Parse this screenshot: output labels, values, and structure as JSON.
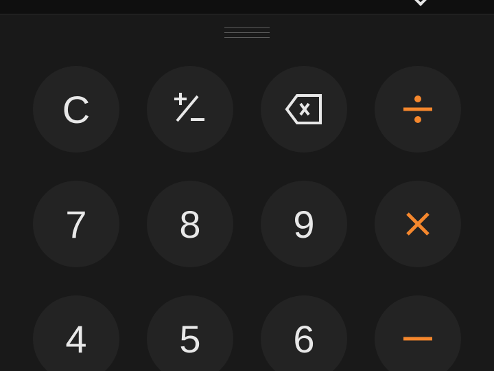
{
  "keypad": {
    "row1": {
      "clear": "C"
    },
    "row2": {
      "seven": "7",
      "eight": "8",
      "nine": "9"
    },
    "row3": {
      "four": "4",
      "five": "5",
      "six": "6"
    }
  },
  "icons": {
    "plus_minus": "plus-minus-icon",
    "backspace": "backspace-icon",
    "divide": "divide-icon",
    "multiply": "multiply-icon",
    "subtract": "minus-icon",
    "top_chevron": "chevron-down-icon"
  },
  "colors": {
    "background": "#191919",
    "key_background": "#232323",
    "digit_text": "#e8e8e8",
    "operator_accent": "#f5872d"
  }
}
